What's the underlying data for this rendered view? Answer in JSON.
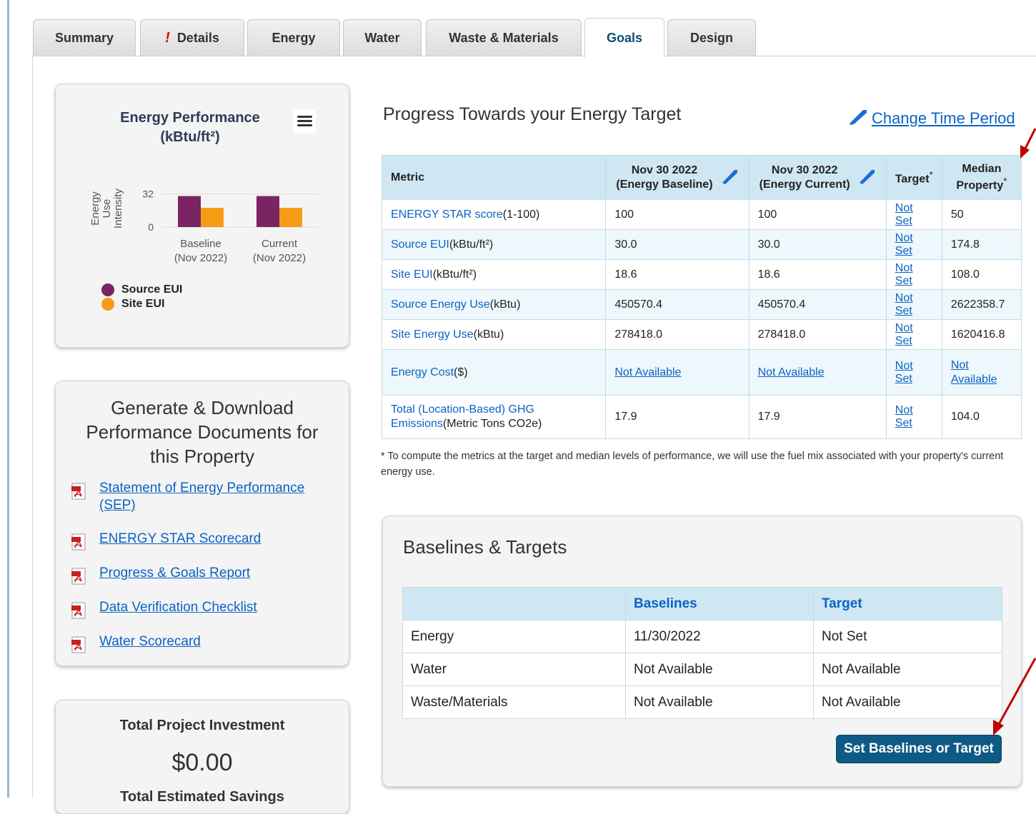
{
  "tabs": [
    {
      "label": "Summary",
      "active": false
    },
    {
      "label": "Details",
      "active": false,
      "alert": "!"
    },
    {
      "label": "Energy",
      "active": false
    },
    {
      "label": "Water",
      "active": false
    },
    {
      "label": "Waste & Materials",
      "active": false
    },
    {
      "label": "Goals",
      "active": true
    },
    {
      "label": "Design",
      "active": false
    }
  ],
  "energy_performance": {
    "title_line1": "Energy Performance",
    "title_line2": "(kBtu/ft²)",
    "menu_icon": "hamburger-menu-icon",
    "chart_data": {
      "type": "bar",
      "title": "Energy Performance (kBtu/ft²)",
      "ylabel_lines": [
        "Energy",
        "Use",
        "Intensity"
      ],
      "yticks": [
        0,
        32
      ],
      "ylim": [
        0,
        38
      ],
      "categories": [
        [
          "Baseline",
          "(Nov 2022)"
        ],
        [
          "Current",
          "(Nov 2022)"
        ]
      ],
      "series": [
        {
          "name": "Source EUI",
          "color": "#7b2463",
          "values": [
            30.0,
            30.0
          ]
        },
        {
          "name": "Site EUI",
          "color": "#f59c16",
          "values": [
            18.6,
            18.6
          ]
        }
      ],
      "legend": "bottom-left"
    }
  },
  "documents": {
    "title_lines": [
      "Generate & Download",
      "Performance Documents for",
      "this Property"
    ],
    "links": [
      {
        "label": "Statement of Energy Performance (SEP)"
      },
      {
        "label": "ENERGY STAR Scorecard"
      },
      {
        "label": "Progress & Goals Report"
      },
      {
        "label": "Data Verification Checklist"
      },
      {
        "label": "Water Scorecard"
      }
    ]
  },
  "investment": {
    "title": "Total Project Investment",
    "value": "$0.00",
    "next_title": "Total Estimated Savings"
  },
  "progress": {
    "title": "Progress Towards your Energy Target",
    "change_link": "Change Time Period",
    "headers": {
      "metric": "Metric",
      "baseline_date": "Nov 30 2022",
      "baseline_sub": "(Energy Baseline)",
      "current_date": "Nov 30 2022",
      "current_sub": "(Energy Current)",
      "target": "Target",
      "target_mark": "*",
      "median_line1": "Median",
      "median_line2": "Property",
      "median_mark": "*"
    },
    "rows": [
      {
        "link": "ENERGY STAR score",
        "unit": "(1-100)",
        "baseline": "100",
        "current": "100",
        "target": "Not Set",
        "median": "50"
      },
      {
        "link": "Source EUI",
        "unit": "(kBtu/ft²)",
        "baseline": "30.0",
        "current": "30.0",
        "target": "Not Set",
        "median": "174.8"
      },
      {
        "link": "Site EUI",
        "unit": "(kBtu/ft²)",
        "baseline": "18.6",
        "current": "18.6",
        "target": "Not Set",
        "median": "108.0"
      },
      {
        "link": "Source Energy Use",
        "unit": "(kBtu)",
        "baseline": "450570.4",
        "current": "450570.4",
        "target": "Not Set",
        "median": "2622358.7"
      },
      {
        "link": "Site Energy Use",
        "unit": "(kBtu)",
        "baseline": "278418.0",
        "current": "278418.0",
        "target": "Not Set",
        "median": "1620416.8"
      },
      {
        "link": "Energy Cost",
        "unit": "($)",
        "baseline": "Not Available",
        "current": "Not Available",
        "target": "Not Set",
        "median": "Not Available"
      },
      {
        "link": "Total (Location-Based) GHG Emissions",
        "unit": "(Metric Tons CO2e)",
        "baseline": "17.9",
        "current": "17.9",
        "target": "Not Set",
        "median": "104.0"
      }
    ],
    "footnote": "* To compute the metrics at the target and median levels of performance, we will use the fuel mix associated with your property's current energy use."
  },
  "baselines_targets": {
    "title": "Baselines & Targets",
    "headers": [
      "",
      "Baselines",
      "Target"
    ],
    "rows": [
      [
        "Energy",
        "11/30/2022",
        "Not Set"
      ],
      [
        "Water",
        "Not Available",
        "Not Available"
      ],
      [
        "Waste/Materials",
        "Not Available",
        "Not Available"
      ]
    ],
    "button": "Set Baselines or Target"
  },
  "colors": {
    "accent_link": "#0b63c5",
    "annotation_arrow": "#c00000",
    "button": "#0f5a85",
    "table_header": "#cfe7f2"
  }
}
